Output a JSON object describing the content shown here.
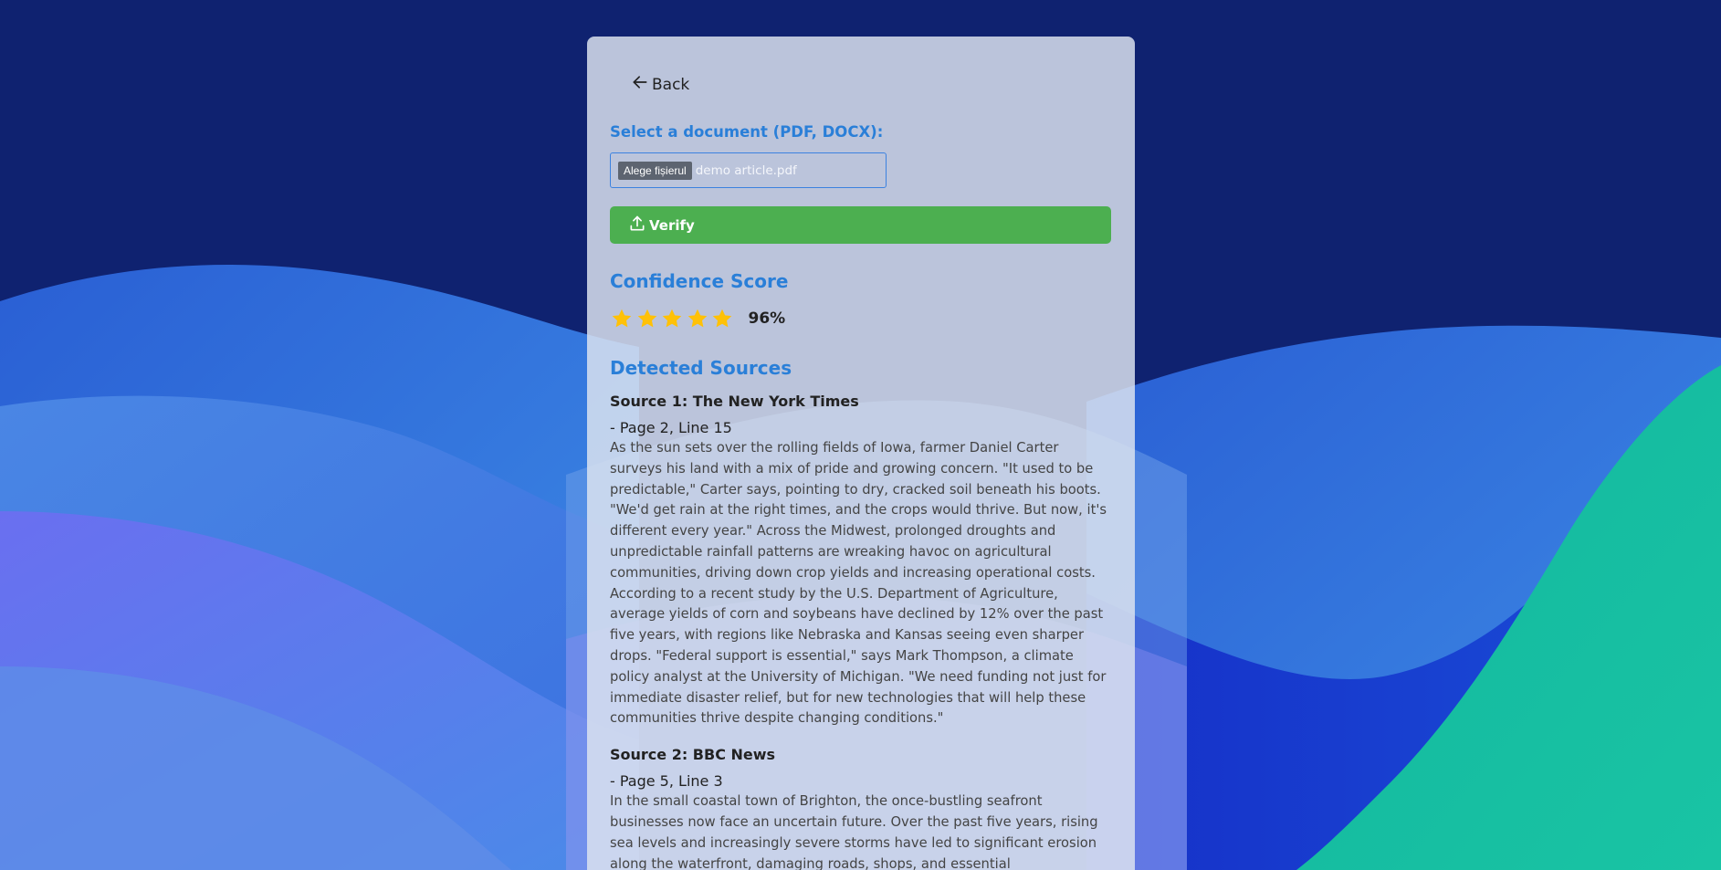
{
  "nav": {
    "back_label": "Back"
  },
  "upload": {
    "label": "Select a document (PDF, DOCX):",
    "choose_button": "Alege fișierul",
    "file_name": "demo article.pdf",
    "verify_label": "Verify"
  },
  "confidence": {
    "heading": "Confidence Score",
    "stars_filled": 5,
    "stars_total": 5,
    "percent_label": "96%"
  },
  "sources": {
    "heading": "Detected Sources",
    "items": [
      {
        "title": "Source 1: The New York Times",
        "location": "- Page 2, Line 15",
        "text": "As the sun sets over the rolling fields of Iowa, farmer Daniel Carter surveys his land with a mix of pride and growing concern. \"It used to be predictable,\" Carter says, pointing to dry, cracked soil beneath his boots. \"We'd get rain at the right times, and the crops would thrive. But now, it's different every year.\" Across the Midwest, prolonged droughts and unpredictable rainfall patterns are wreaking havoc on agricultural communities, driving down crop yields and increasing operational costs. According to a recent study by the U.S. Department of Agriculture, average yields of corn and soybeans have declined by 12% over the past five years, with regions like Nebraska and Kansas seeing even sharper drops. \"Federal support is essential,\" says Mark Thompson, a climate policy analyst at the University of Michigan. \"We need funding not just for immediate disaster relief, but for new technologies that will help these communities thrive despite changing conditions.\""
      },
      {
        "title": "Source 2: BBC News",
        "location": "- Page 5, Line 3",
        "text": "In the small coastal town of Brighton, the once-bustling seafront businesses now face an uncertain future. Over the past five years, rising sea levels and increasingly severe storms have led to significant erosion along the waterfront, damaging roads, shops, and essential"
      }
    ]
  },
  "colors": {
    "accent": "#2a7fd8",
    "verify_button": "#4caf50",
    "star": "#ffc107",
    "background_top": "#0f2270"
  },
  "icons": {
    "back": "arrow-left-icon",
    "verify": "upload-icon",
    "star": "star-icon"
  }
}
